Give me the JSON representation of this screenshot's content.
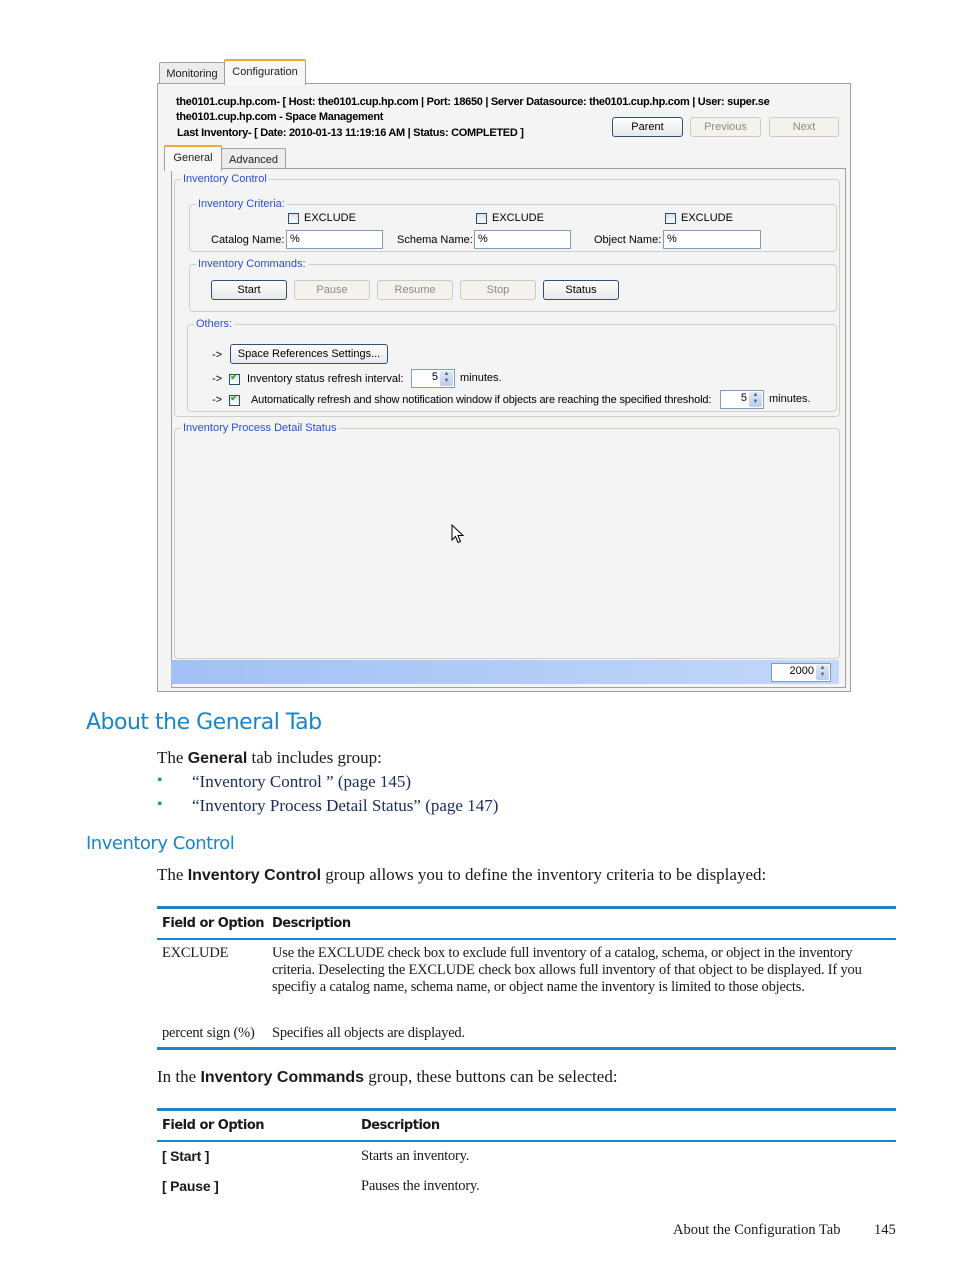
{
  "app": {
    "tabs": [
      {
        "label": "Monitoring",
        "active": false
      },
      {
        "label": "Configuration",
        "active": true
      }
    ],
    "header": {
      "line1": "the0101.cup.hp.com- [ Host: the0101.cup.hp.com | Port: 18650 | Server Datasource: the0101.cup.hp.com | User: super.se",
      "line2": "the0101.cup.hp.com - Space Management",
      "line3": "Last Inventory- [ Date: 2010-01-13 11:19:16 AM | Status: COMPLETED ]"
    },
    "nav_buttons": {
      "parent": "Parent",
      "previous": "Previous",
      "next": "Next"
    },
    "sub_tabs": [
      {
        "label": "General",
        "active": true
      },
      {
        "label": "Advanced",
        "active": false
      }
    ],
    "inventory_control": {
      "title": "Inventory Control",
      "criteria": {
        "title": "Inventory Criteria:",
        "exclude_label": "EXCLUDE",
        "catalog": {
          "label": "Catalog Name:",
          "value": "%",
          "exclude_checked": false
        },
        "schema": {
          "label": "Schema Name:",
          "value": "%",
          "exclude_checked": false
        },
        "object": {
          "label": "Object Name:",
          "value": "%",
          "exclude_checked": false
        }
      },
      "commands": {
        "title": "Inventory Commands:",
        "start": "Start",
        "pause": "Pause",
        "resume": "Resume",
        "stop": "Stop",
        "status": "Status"
      },
      "others": {
        "title": "Others:",
        "arrow": "->",
        "space_ref_button": "Space References Settings...",
        "refresh_interval_label": "Inventory status refresh interval:",
        "refresh_interval_value": "5",
        "refresh_interval_checked": true,
        "minutes": "minutes.",
        "auto_refresh_label": "Automatically refresh and show notification window if objects are reaching the specified threshold:",
        "auto_refresh_value": "5",
        "auto_refresh_checked": true
      }
    },
    "process_detail": {
      "title": "Inventory Process Detail Status"
    },
    "statusbar": {
      "value": "2000"
    }
  },
  "doc": {
    "heading": "About the General Tab",
    "intro": {
      "pre": "The ",
      "bold": "General",
      "post": " tab includes group:"
    },
    "bullets": [
      "“Inventory Control ” (page 145)",
      "“Inventory Process Detail Status” (page 147)"
    ],
    "subheading": "Inventory Control",
    "ic_intro": {
      "pre": "The ",
      "bold": "Inventory Control",
      "post": " group allows you to define the inventory criteria to be displayed:"
    },
    "table1": {
      "headers": [
        "Field or Option",
        "Description"
      ],
      "rows": [
        [
          "EXCLUDE",
          "Use the EXCLUDE check box to exclude full inventory of a catalog, schema, or object in the inventory criteria. Deselecting the EXCLUDE check box allows full inventory of that object to be displayed. If you specifiy a catalog name, schema name, or object name the inventory is limited to those objects."
        ],
        [
          "percent sign (%)",
          "Specifies all objects are displayed."
        ]
      ]
    },
    "cmd_intro": {
      "pre": "In the ",
      "bold": "Inventory Commands",
      "post": " group, these buttons can be selected:"
    },
    "table2": {
      "headers": [
        "Field or Option",
        "Description"
      ],
      "rows": [
        [
          "[ Start ]",
          "Starts an inventory."
        ],
        [
          "[ Pause ]",
          "Pauses the inventory."
        ]
      ]
    },
    "footer": {
      "section": "About the Configuration Tab",
      "page": "145"
    }
  }
}
